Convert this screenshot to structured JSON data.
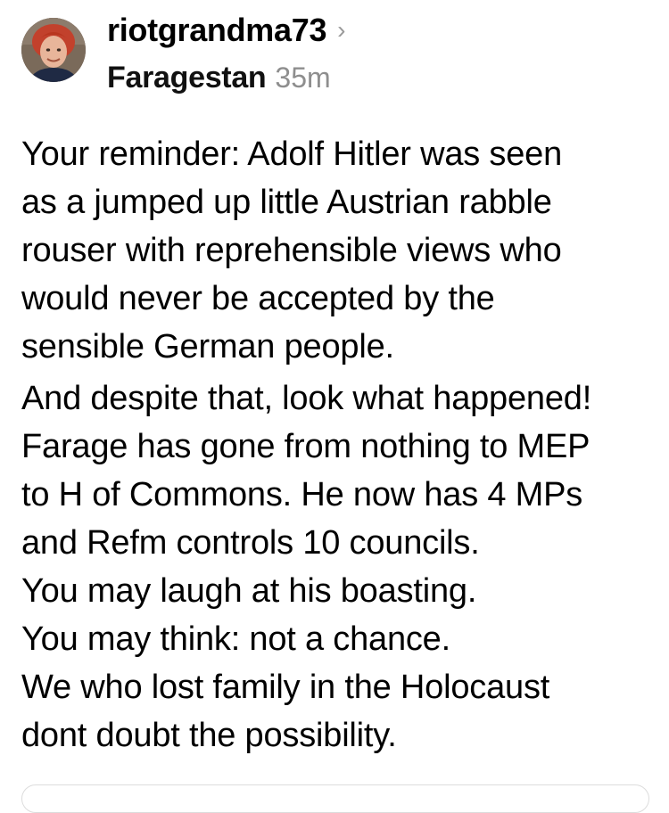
{
  "post": {
    "username": "riotgrandma73",
    "username_chevron": "›",
    "community": "Faragestan",
    "time": "35m",
    "avatar_icon": "avatar-photo",
    "lines": [
      "Your reminder: Adolf Hitler was seen",
      "as a jumped up little Austrian rabble",
      "rouser with reprehensible views who",
      "would never be accepted by the",
      "sensible German people.",
      "And despite that, look what happened!",
      "Farage has gone from nothing to MEP",
      "to H of Commons. He now has 4 MPs",
      "and Refm controls 10 councils.",
      "You may laugh at his boasting.",
      "You may think: not a chance.",
      "We who lost family in the Holocaust",
      "dont doubt the possibility."
    ]
  },
  "colors": {
    "text": "#000000",
    "muted": "#8e8e8e",
    "chevron": "#9a9a9a",
    "background": "#ffffff"
  }
}
